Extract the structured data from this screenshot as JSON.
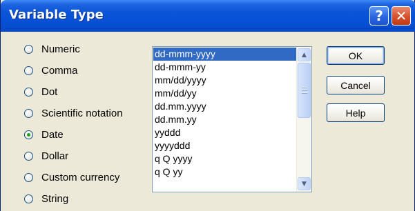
{
  "window": {
    "title": "Variable Type",
    "help_glyph": "?",
    "close_glyph": "✕"
  },
  "radio_options": [
    {
      "label": "Numeric",
      "checked": false
    },
    {
      "label": "Comma",
      "checked": false
    },
    {
      "label": "Dot",
      "checked": false
    },
    {
      "label": "Scientific notation",
      "checked": false
    },
    {
      "label": "Date",
      "checked": true
    },
    {
      "label": "Dollar",
      "checked": false
    },
    {
      "label": "Custom currency",
      "checked": false
    },
    {
      "label": "String",
      "checked": false
    }
  ],
  "date_formats": {
    "items": [
      "dd-mmm-yyyy",
      "dd-mmm-yy",
      "mm/dd/yyyy",
      "mm/dd/yy",
      "dd.mm.yyyy",
      "dd.mm.yy",
      "yyddd",
      "yyyyddd",
      "q Q yyyy",
      "q Q yy"
    ],
    "selected": "dd-mmm-yyyy"
  },
  "buttons": {
    "ok": "OK",
    "cancel": "Cancel",
    "help": "Help"
  },
  "scrollbar": {
    "up_arrow": "▲",
    "down_arrow": "▼"
  },
  "colors": {
    "titlebar": "#0550D4",
    "selection": "#316AC5",
    "dialog_bg": "#ECE9D8",
    "radio_dot": "#21A121",
    "close_button": "#D7502B"
  }
}
